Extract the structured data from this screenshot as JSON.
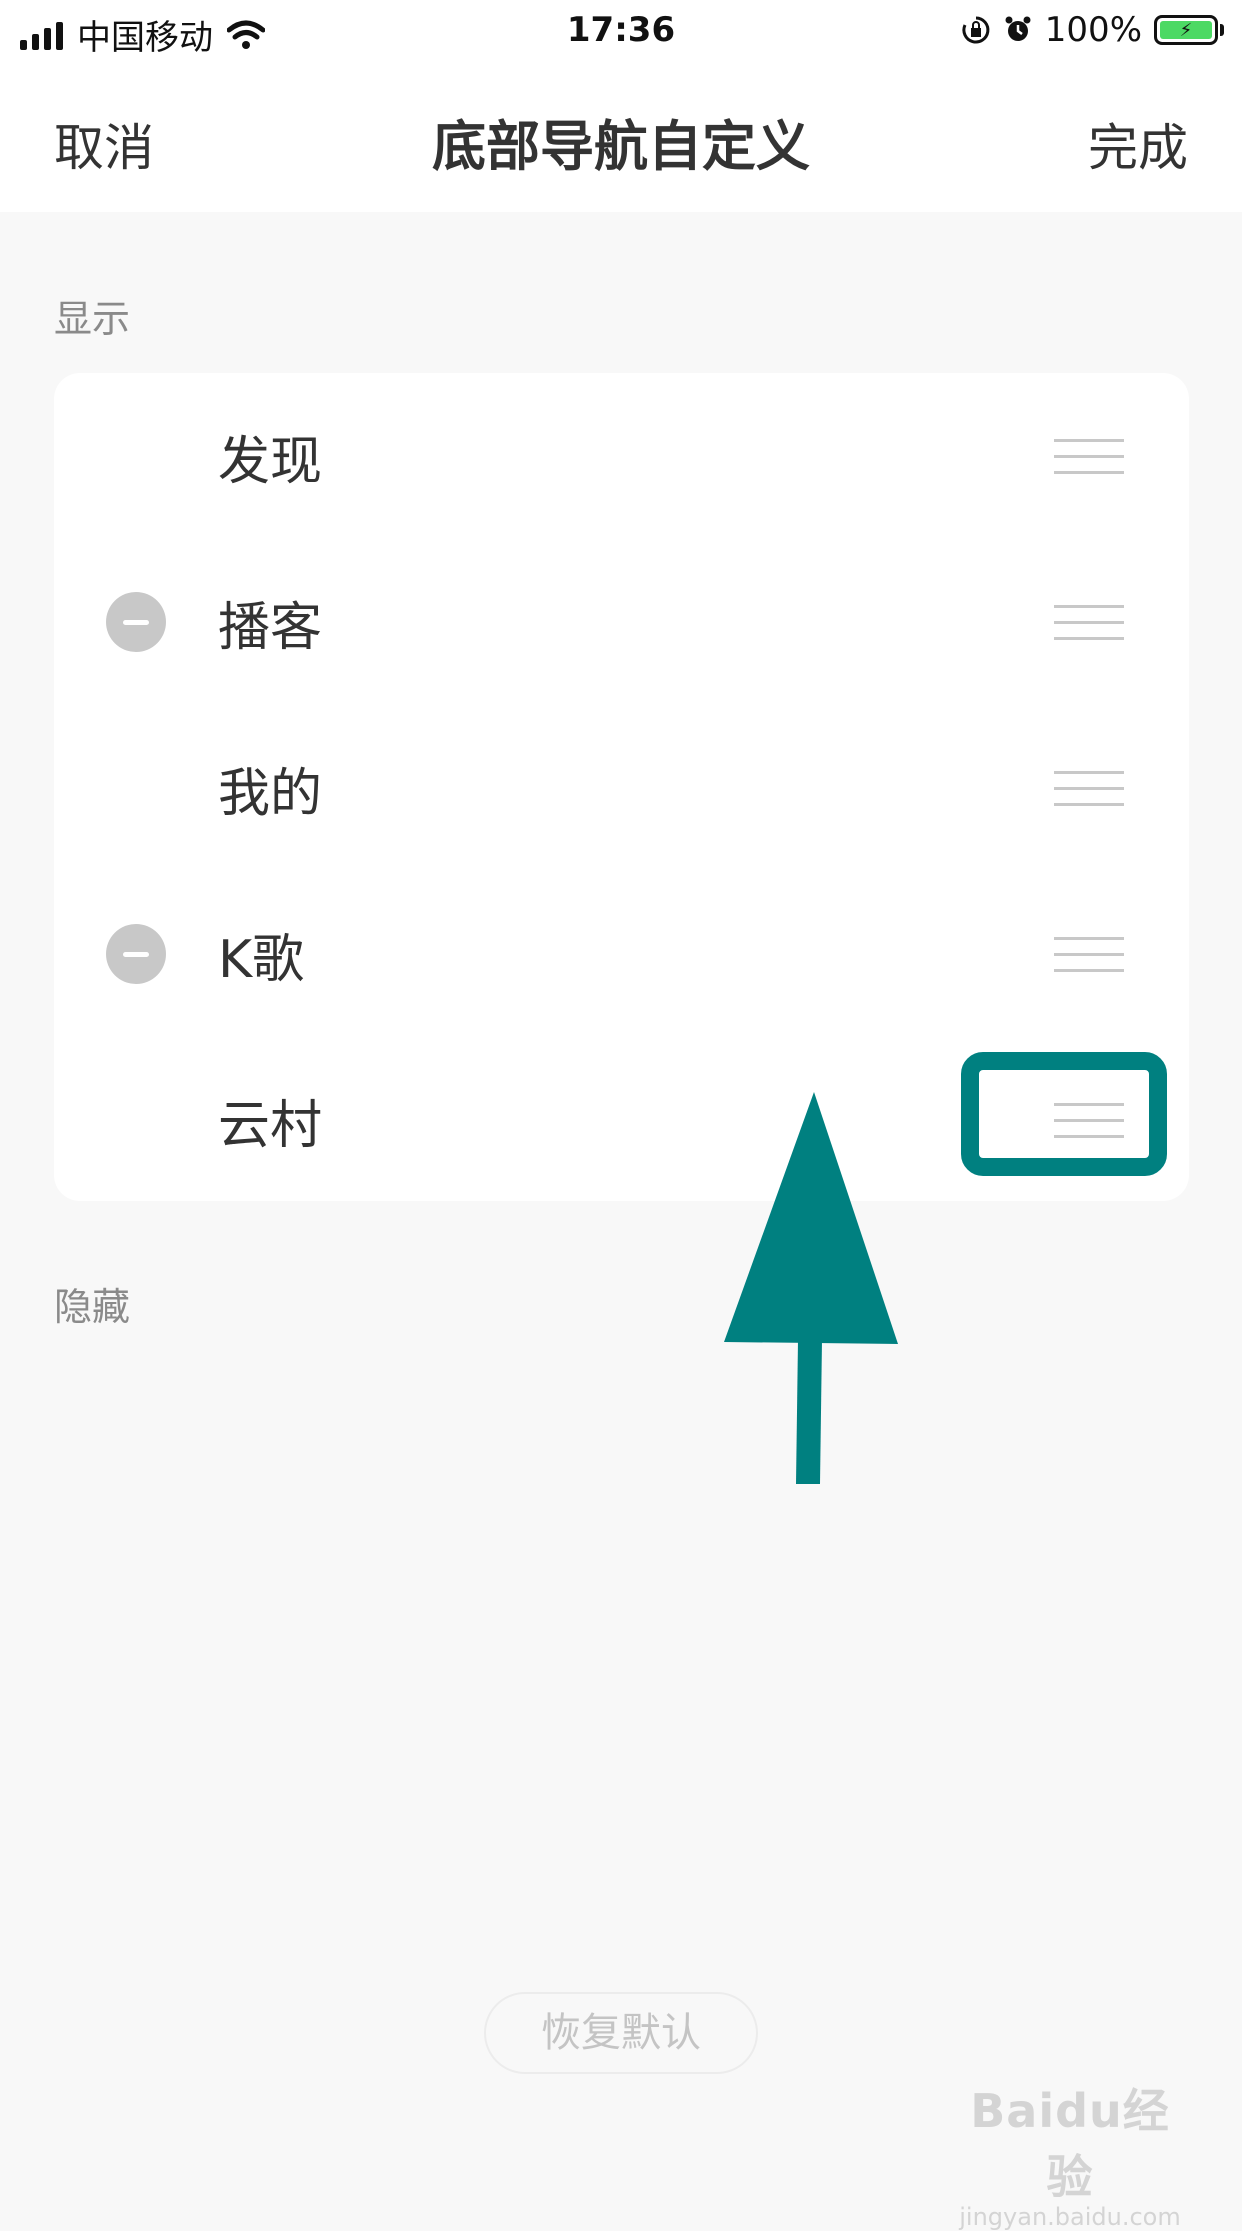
{
  "status_bar": {
    "carrier": "中国移动",
    "time": "17:36",
    "battery_percent": "100%",
    "icons": [
      "signal-icon",
      "wifi-icon",
      "orientation-lock-icon",
      "alarm-icon",
      "battery-charging-icon"
    ]
  },
  "nav": {
    "cancel_label": "取消",
    "title": "底部导航自定义",
    "done_label": "完成"
  },
  "shown_section": {
    "header": "显示",
    "items": [
      {
        "label": "发现",
        "removable": false
      },
      {
        "label": "播客",
        "removable": true
      },
      {
        "label": "我的",
        "removable": false
      },
      {
        "label": "K歌",
        "removable": true
      },
      {
        "label": "云村",
        "removable": false
      }
    ]
  },
  "hidden_section": {
    "header": "隐藏"
  },
  "restore_default_label": "恢复默认",
  "annotation": {
    "color": "#008080"
  },
  "watermark": {
    "logo": "Baidu经验",
    "url": "jingyan.baidu.com"
  }
}
